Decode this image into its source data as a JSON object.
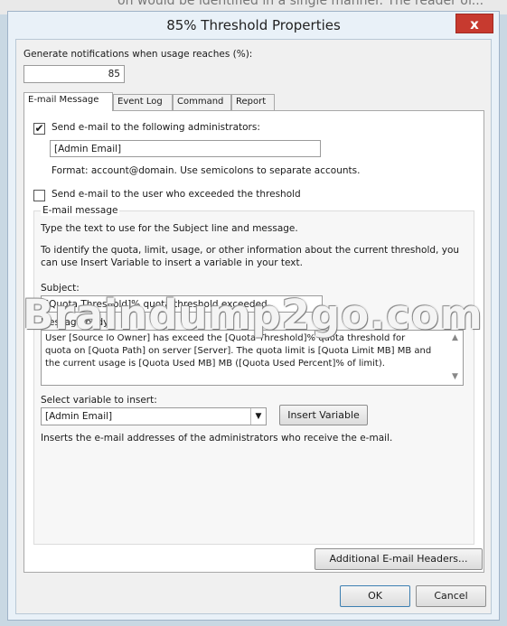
{
  "window": {
    "title": "85% Threshold Properties",
    "close_glyph": "x"
  },
  "top_strip_text": "on would be identified in a single manner. The reader of...",
  "notification": {
    "label": "Generate notifications when usage reaches (%):",
    "value": "85"
  },
  "tabs": [
    {
      "label": "E-mail Message"
    },
    {
      "label": "Event Log"
    },
    {
      "label": "Command"
    },
    {
      "label": "Report"
    }
  ],
  "email": {
    "send_admins_checked": true,
    "send_admins_label": "Send e-mail to the following administrators:",
    "admins_value": "[Admin Email]",
    "format_hint": "Format: account@domain. Use semicolons to separate accounts.",
    "send_user_checked": false,
    "send_user_label": "Send e-mail to the user who exceeded the threshold",
    "group_label": "E-mail message",
    "intro_1": "Type the text to use for the Subject line and message.",
    "intro_2a": "To identify the quota, limit, usage, or other information about the current threshold, you",
    "intro_2b": "can use Insert Variable to insert a variable in your text.",
    "subject_label": "Subject:",
    "subject_value": "[Quota Threshold]% quota threshold exceeded",
    "body_label": "Message body:",
    "body_line_1": "User [Source Io Owner] has exceed the [Quota Threshold]% quota threshold for",
    "body_line_2": "quota on [Quota Path] on server [Server]. The quota limit is [Quota Limit MB] MB and",
    "body_line_3": "the current usage is [Quota Used MB] MB ([Quota Used Percent]% of limit).",
    "variable_label": "Select variable to insert:",
    "variable_selected": "[Admin Email]",
    "insert_button": "Insert Variable",
    "variable_desc": "Inserts the e-mail addresses of the administrators who receive the e-mail.",
    "headers_button": "Additional E-mail Headers..."
  },
  "footer": {
    "ok": "OK",
    "cancel": "Cancel"
  },
  "watermark": "Braindump2go.com",
  "colors": {
    "close": "#c73a2f",
    "window_frame": "#e9f1f8",
    "client": "#f0f0f0"
  }
}
